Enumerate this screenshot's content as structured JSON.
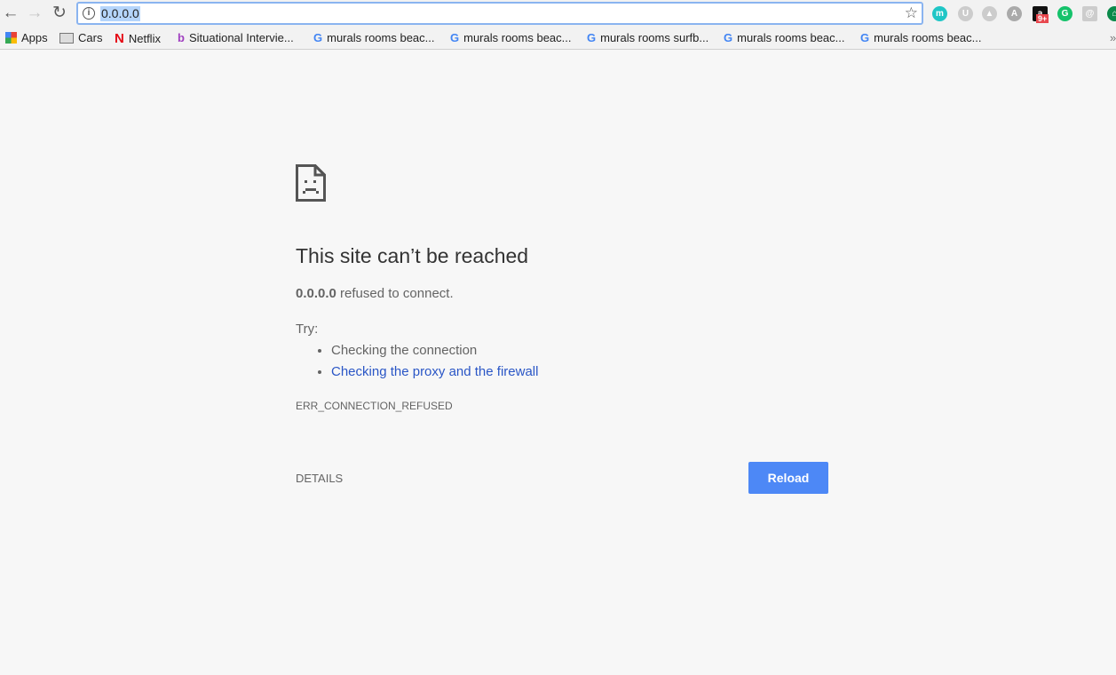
{
  "toolbar": {
    "url": "0.0.0.0",
    "back_icon": "arrow-left",
    "forward_icon": "arrow-right",
    "reload_icon": "reload",
    "badge": "9+",
    "extensions": [
      {
        "letter": "m",
        "color": "#1fc6c6"
      },
      {
        "letter": "U",
        "color": "#cccccc"
      },
      {
        "letter": "▲",
        "color": "#cccccc"
      },
      {
        "letter": "A",
        "color": "#aaaaaa"
      },
      {
        "letter": "a",
        "color": "#111111"
      },
      {
        "letter": "G",
        "color": "#15c26b"
      },
      {
        "letter": "@",
        "color": "#cccccc"
      },
      {
        "letter": "⌂",
        "color": "#0b8a4a"
      }
    ]
  },
  "bookmarks": [
    "Apps",
    "Cars",
    "Netflix",
    "Situational Intervie...",
    "murals rooms beac...",
    "murals rooms beac...",
    "murals rooms surfb...",
    "murals rooms beac...",
    "murals rooms beac..."
  ],
  "error": {
    "title": "This site can’t be reached",
    "host": "0.0.0.0",
    "message": " refused to connect.",
    "try": "Try:",
    "suggestions": [
      "Checking the connection",
      "Checking the proxy and the firewall"
    ],
    "code": "ERR_CONNECTION_REFUSED",
    "details": "DETAILS",
    "reload": "Reload"
  },
  "colors": {
    "accent": "#4d88f6",
    "link": "#2a56c6"
  }
}
